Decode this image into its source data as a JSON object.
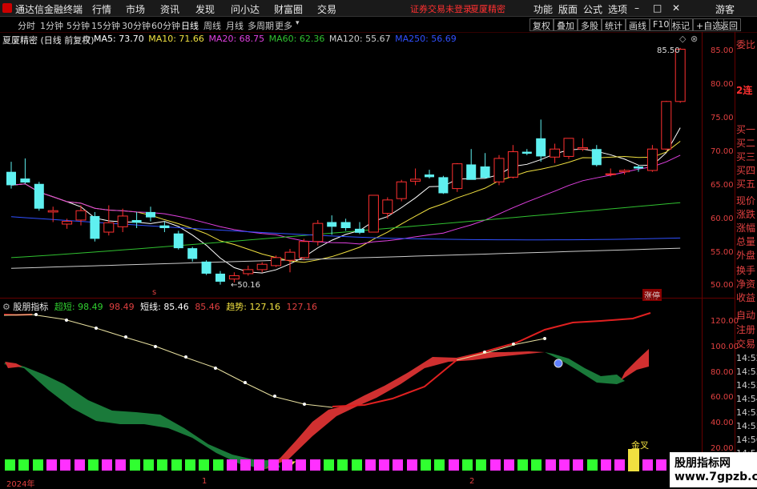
{
  "app": {
    "title": "通达信金融终端",
    "menu": [
      "行情",
      "市场",
      "资讯",
      "发现",
      "问小达",
      "财富圈",
      "交易"
    ],
    "login_status": "证券交易未登录",
    "stock_name_top": "夏厦精密",
    "right_menu": [
      "功能",
      "版面",
      "公式",
      "选项"
    ],
    "guest": "游客"
  },
  "periods": {
    "items": [
      "分时",
      "1分钟",
      "5分钟",
      "15分钟",
      "30分钟",
      "60分钟",
      "日线",
      "周线",
      "月线",
      "多周期",
      "更多"
    ],
    "active": "日线"
  },
  "toolbar": {
    "buttons": [
      "复权",
      "叠加",
      "多股",
      "统计",
      "画线",
      "F10",
      "标记",
      "+自选",
      "返回"
    ]
  },
  "main_panel": {
    "header": "夏厦精密 (日线 前复权)",
    "ma": [
      {
        "label": "MA5: 73.70",
        "color": "#ffffff"
      },
      {
        "label": "MA10: 71.66",
        "color": "#f0e040"
      },
      {
        "label": "MA20: 68.75",
        "color": "#e040e0"
      },
      {
        "label": "MA60: 62.36",
        "color": "#30c030"
      },
      {
        "label": "MA120: 55.67",
        "color": "#cccccc"
      },
      {
        "label": "MA250: 56.69",
        "color": "#3050ff"
      }
    ],
    "high_label": "85.50",
    "low_label": "50.16",
    "zt_label": "涨停",
    "s_marker": "s",
    "y_ticks": [
      "85.00",
      "80.00",
      "75.00",
      "70.00",
      "65.00",
      "60.00",
      "55.00",
      "50.00"
    ]
  },
  "sub_panel": {
    "name": "股朋指标",
    "values": [
      {
        "label": "超短:",
        "value": "98.49",
        "color": "#30d030"
      },
      {
        "label": "",
        "value": "98.49",
        "color": "#e04040"
      },
      {
        "label": "短线:",
        "value": "85.46",
        "color": "#ffffff"
      },
      {
        "label": "",
        "value": "85.46",
        "color": "#e04040"
      },
      {
        "label": "趋势:",
        "value": "127.16",
        "color": "#f0e040"
      },
      {
        "label": "",
        "value": "127.16",
        "color": "#e04040"
      }
    ],
    "y_ticks": [
      "120.00",
      "100.00",
      "80.00",
      "60.00",
      "40.00",
      "20.00"
    ],
    "jincha": "金叉"
  },
  "side_labels": [
    "委比",
    "2连",
    "买一",
    "买二",
    "买三",
    "买四",
    "买五",
    "现价",
    "涨跌",
    "涨幅",
    "总量",
    "外盘",
    "换手",
    "净资",
    "收益",
    "自动",
    "注册",
    "交易"
  ],
  "side_times": [
    "14:52",
    "14:53",
    "14:53",
    "14:54",
    "14:55",
    "14:55",
    "14:56",
    "14:56"
  ],
  "x_labels": [
    "2024年",
    "1",
    "2"
  ],
  "watermark": {
    "line1": "股朋指标网",
    "line2": "www.7gpzb.com"
  },
  "chart_data": {
    "type": "candlestick",
    "ylim": [
      48.5,
      87.5
    ],
    "candles": [
      [
        67.0,
        68.5,
        64.5,
        65.0
      ],
      [
        66.0,
        69.0,
        65.2,
        65.4
      ],
      [
        65.2,
        65.5,
        61.2,
        61.5
      ],
      [
        61.0,
        61.8,
        59.5,
        61.2
      ],
      [
        59.2,
        60.0,
        58.5,
        59.6
      ],
      [
        59.8,
        62.0,
        59.0,
        61.2
      ],
      [
        60.4,
        61.0,
        56.6,
        57.0
      ],
      [
        58.0,
        62.0,
        57.5,
        59.4
      ],
      [
        58.8,
        61.5,
        58.0,
        60.4
      ],
      [
        59.8,
        61.0,
        58.6,
        59.4
      ],
      [
        61.0,
        61.8,
        59.6,
        60.2
      ],
      [
        59.0,
        59.6,
        58.0,
        58.6
      ],
      [
        57.8,
        58.2,
        55.4,
        55.6
      ],
      [
        55.6,
        55.8,
        53.6,
        54.0
      ],
      [
        53.6,
        53.8,
        51.6,
        51.8
      ],
      [
        51.8,
        52.2,
        50.16,
        50.6
      ],
      [
        51.0,
        52.0,
        50.5,
        51.5
      ],
      [
        51.8,
        53.0,
        51.5,
        52.4
      ],
      [
        52.4,
        53.5,
        52.0,
        53.2
      ],
      [
        53.0,
        54.5,
        52.8,
        54.2
      ],
      [
        53.8,
        55.5,
        52.0,
        55.0
      ],
      [
        54.2,
        57.0,
        53.8,
        56.6
      ],
      [
        56.6,
        59.8,
        56.0,
        59.3
      ],
      [
        59.5,
        60.5,
        57.6,
        58.8
      ],
      [
        59.5,
        60.0,
        58.2,
        58.6
      ],
      [
        58.5,
        59.5,
        57.7,
        57.9
      ],
      [
        58.0,
        63.5,
        58.0,
        63.5
      ],
      [
        60.8,
        63.2,
        60.0,
        62.8
      ],
      [
        63.0,
        65.8,
        62.6,
        65.5
      ],
      [
        65.6,
        67.5,
        65.0,
        65.9
      ],
      [
        66.6,
        67.3,
        66.0,
        66.2
      ],
      [
        66.2,
        66.4,
        63.7,
        63.8
      ],
      [
        64.5,
        68.3,
        64.0,
        68.2
      ],
      [
        68.1,
        70.4,
        67.0,
        65.8
      ],
      [
        67.8,
        69.8,
        66.0,
        66.1
      ],
      [
        65.5,
        69.5,
        65.0,
        69.0
      ],
      [
        66.2,
        71.0,
        66.0,
        70.0
      ],
      [
        70.0,
        70.4,
        69.5,
        69.7
      ],
      [
        72.0,
        74.8,
        68.5,
        69.3
      ],
      [
        69.2,
        71.2,
        68.3,
        70.4
      ],
      [
        69.3,
        72.0,
        68.9,
        72.0
      ],
      [
        70.4,
        72.0,
        70.1,
        70.6
      ],
      [
        70.4,
        71.0,
        67.8,
        68.0
      ],
      [
        66.6,
        67.5,
        66.3,
        66.7
      ],
      [
        67.0,
        67.4,
        66.6,
        67.2
      ],
      [
        67.8,
        68.0,
        67.0,
        67.5
      ],
      [
        67.2,
        71.0,
        67.0,
        70.4
      ],
      [
        70.4,
        77.6,
        70.2,
        77.5
      ],
      [
        77.5,
        85.5,
        77.3,
        85.3
      ]
    ]
  }
}
